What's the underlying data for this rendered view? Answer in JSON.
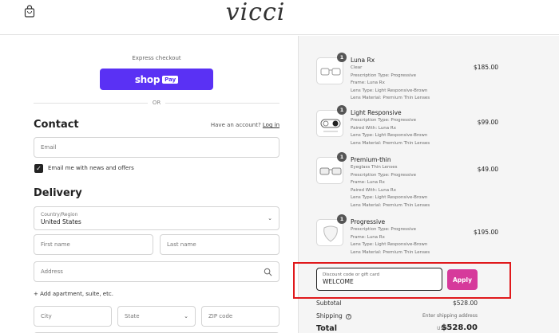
{
  "header": {
    "logo": "vicci",
    "bag_icon": "shopping-bag-icon"
  },
  "express": {
    "label": "Express checkout",
    "shop_pay_label": "shop",
    "shop_pay_badge": "Pay"
  },
  "divider": {
    "label": "OR"
  },
  "contact": {
    "title": "Contact",
    "have_account": "Have an account?",
    "login": "Log in",
    "email_placeholder": "Email",
    "newsletter_label": "Email me with news and offers",
    "newsletter_checked": true
  },
  "delivery": {
    "title": "Delivery",
    "country_label": "Country/Region",
    "country_value": "United States",
    "first_name_placeholder": "First name",
    "last_name_placeholder": "Last name",
    "address_placeholder": "Address",
    "add_apartment": "+ Add apartment, suite, etc.",
    "city_placeholder": "City",
    "state_placeholder": "State",
    "zip_placeholder": "ZIP code"
  },
  "order": {
    "items": [
      {
        "qty": "1",
        "name": "Luna Rx",
        "price": "$185.00",
        "lines": [
          "Clear",
          "Prescription Type: Progressive",
          "Frame: Luna Rx",
          "Lens Type: Light Responsive-Brown",
          "Lens Material: Premium Thin Lenses"
        ]
      },
      {
        "qty": "1",
        "name": "Light Responsive",
        "price": "$99.00",
        "lines": [
          "Prescription Type: Progressive",
          "Paired With: Luna Rx",
          "Lens Type: Light Responsive-Brown",
          "Lens Material: Premium Thin Lenses"
        ]
      },
      {
        "qty": "1",
        "name": "Premium-thin",
        "price": "$49.00",
        "lines": [
          "Eyeglass Thin Lenses",
          "Prescription Type: Progressive",
          "Frame: Luna Rx",
          "Paired With: Luna Rx",
          "Lens Type: Light Responsive-Brown",
          "Lens Material: Premium Thin Lenses"
        ]
      },
      {
        "qty": "1",
        "name": "Progressive",
        "price": "$195.00",
        "lines": [
          "Prescription Type: Progressive",
          "Frame: Luna Rx",
          "Lens Type: Light Responsive-Brown",
          "Lens Material: Premium Thin Lenses"
        ]
      }
    ],
    "discount_label": "Discount code or gift card",
    "discount_value": "WELCOME",
    "apply_label": "Apply",
    "subtotal_label": "Subtotal",
    "subtotal_value": "$528.00",
    "shipping_label": "Shipping",
    "shipping_value": "Enter shipping address",
    "total_label": "Total",
    "total_currency": "USD",
    "total_value": "$528.00"
  },
  "colors": {
    "shop_pay": "#5a31f4",
    "apply": "#d63a9b",
    "highlight": "#e0191c",
    "sidebar_bg": "#f5f5f5"
  }
}
